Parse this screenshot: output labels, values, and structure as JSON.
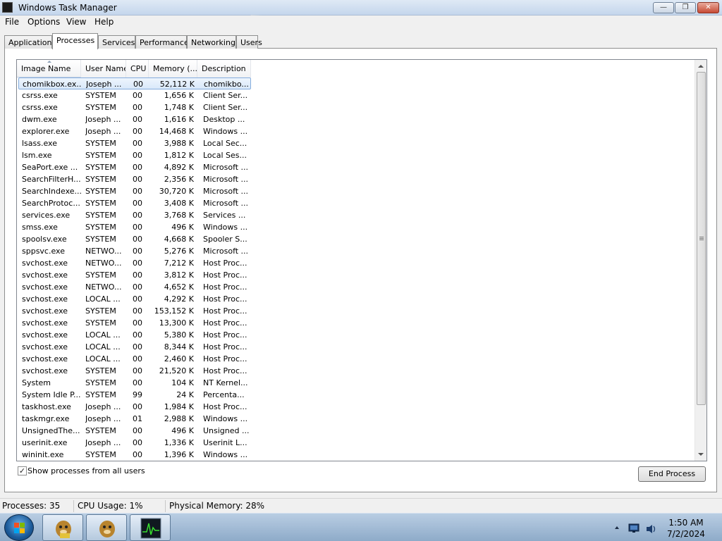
{
  "window": {
    "title": "Windows Task Manager",
    "buttons": {
      "minimize": "—",
      "maximize": "❐",
      "close": "✕"
    }
  },
  "menu": [
    "File",
    "Options",
    "View",
    "Help"
  ],
  "tabs": [
    "Applications",
    "Processes",
    "Services",
    "Performance",
    "Networking",
    "Users"
  ],
  "active_tab": "Processes",
  "columns": [
    "Image Name",
    "User Name",
    "CPU",
    "Memory (...",
    "Description"
  ],
  "processes": [
    {
      "name": "chomikbox.ex...",
      "user": "Joseph ...",
      "cpu": "00",
      "mem": "52,112 K",
      "desc": "chomikbo..."
    },
    {
      "name": "csrss.exe",
      "user": "SYSTEM",
      "cpu": "00",
      "mem": "1,656 K",
      "desc": "Client Ser..."
    },
    {
      "name": "csrss.exe",
      "user": "SYSTEM",
      "cpu": "00",
      "mem": "1,748 K",
      "desc": "Client Ser..."
    },
    {
      "name": "dwm.exe",
      "user": "Joseph ...",
      "cpu": "00",
      "mem": "1,616 K",
      "desc": "Desktop ..."
    },
    {
      "name": "explorer.exe",
      "user": "Joseph ...",
      "cpu": "00",
      "mem": "14,468 K",
      "desc": "Windows ..."
    },
    {
      "name": "lsass.exe",
      "user": "SYSTEM",
      "cpu": "00",
      "mem": "3,988 K",
      "desc": "Local Sec..."
    },
    {
      "name": "lsm.exe",
      "user": "SYSTEM",
      "cpu": "00",
      "mem": "1,812 K",
      "desc": "Local Ses..."
    },
    {
      "name": "SeaPort.exe ...",
      "user": "SYSTEM",
      "cpu": "00",
      "mem": "4,892 K",
      "desc": "Microsoft ..."
    },
    {
      "name": "SearchFilterH...",
      "user": "SYSTEM",
      "cpu": "00",
      "mem": "2,356 K",
      "desc": "Microsoft ..."
    },
    {
      "name": "SearchIndexe...",
      "user": "SYSTEM",
      "cpu": "00",
      "mem": "30,720 K",
      "desc": "Microsoft ..."
    },
    {
      "name": "SearchProtoc...",
      "user": "SYSTEM",
      "cpu": "00",
      "mem": "3,408 K",
      "desc": "Microsoft ..."
    },
    {
      "name": "services.exe",
      "user": "SYSTEM",
      "cpu": "00",
      "mem": "3,768 K",
      "desc": "Services ..."
    },
    {
      "name": "smss.exe",
      "user": "SYSTEM",
      "cpu": "00",
      "mem": "496 K",
      "desc": "Windows ..."
    },
    {
      "name": "spoolsv.exe",
      "user": "SYSTEM",
      "cpu": "00",
      "mem": "4,668 K",
      "desc": "Spooler S..."
    },
    {
      "name": "sppsvc.exe",
      "user": "NETWO...",
      "cpu": "00",
      "mem": "5,276 K",
      "desc": "Microsoft ..."
    },
    {
      "name": "svchost.exe",
      "user": "NETWO...",
      "cpu": "00",
      "mem": "7,212 K",
      "desc": "Host Proc..."
    },
    {
      "name": "svchost.exe",
      "user": "SYSTEM",
      "cpu": "00",
      "mem": "3,812 K",
      "desc": "Host Proc..."
    },
    {
      "name": "svchost.exe",
      "user": "NETWO...",
      "cpu": "00",
      "mem": "4,652 K",
      "desc": "Host Proc..."
    },
    {
      "name": "svchost.exe",
      "user": "LOCAL ...",
      "cpu": "00",
      "mem": "4,292 K",
      "desc": "Host Proc..."
    },
    {
      "name": "svchost.exe",
      "user": "SYSTEM",
      "cpu": "00",
      "mem": "153,152 K",
      "desc": "Host Proc..."
    },
    {
      "name": "svchost.exe",
      "user": "SYSTEM",
      "cpu": "00",
      "mem": "13,300 K",
      "desc": "Host Proc..."
    },
    {
      "name": "svchost.exe",
      "user": "LOCAL ...",
      "cpu": "00",
      "mem": "5,380 K",
      "desc": "Host Proc..."
    },
    {
      "name": "svchost.exe",
      "user": "LOCAL ...",
      "cpu": "00",
      "mem": "8,344 K",
      "desc": "Host Proc..."
    },
    {
      "name": "svchost.exe",
      "user": "LOCAL ...",
      "cpu": "00",
      "mem": "2,460 K",
      "desc": "Host Proc..."
    },
    {
      "name": "svchost.exe",
      "user": "SYSTEM",
      "cpu": "00",
      "mem": "21,520 K",
      "desc": "Host Proc..."
    },
    {
      "name": "System",
      "user": "SYSTEM",
      "cpu": "00",
      "mem": "104 K",
      "desc": "NT Kernel..."
    },
    {
      "name": "System Idle P...",
      "user": "SYSTEM",
      "cpu": "99",
      "mem": "24 K",
      "desc": "Percenta..."
    },
    {
      "name": "taskhost.exe",
      "user": "Joseph ...",
      "cpu": "00",
      "mem": "1,984 K",
      "desc": "Host Proc..."
    },
    {
      "name": "taskmgr.exe",
      "user": "Joseph ...",
      "cpu": "01",
      "mem": "2,988 K",
      "desc": "Windows ..."
    },
    {
      "name": "UnsignedThe...",
      "user": "SYSTEM",
      "cpu": "00",
      "mem": "496 K",
      "desc": "Unsigned ..."
    },
    {
      "name": "userinit.exe",
      "user": "Joseph ...",
      "cpu": "00",
      "mem": "1,336 K",
      "desc": "Userinit L..."
    },
    {
      "name": "wininit.exe",
      "user": "SYSTEM",
      "cpu": "00",
      "mem": "1,396 K",
      "desc": "Windows ..."
    }
  ],
  "selected_row": 0,
  "show_all_users": {
    "label": "Show processes from all users",
    "checked": true,
    "mark": "✓"
  },
  "end_process_label": "End Process",
  "status": {
    "processes": "Processes: 35",
    "cpu": "CPU Usage: 1%",
    "memory": "Physical Memory: 28%"
  },
  "taskbar": {
    "items": [
      "start-orb",
      "chomikbox-icon",
      "chomikbox-icon",
      "task-manager-icon"
    ],
    "clock_time": "1:50 AM",
    "clock_date": "7/2/2024"
  },
  "icons": [
    "app-icon",
    "sort-arrow-icon",
    "scroll-up-icon",
    "scroll-down-icon",
    "checkbox-icon",
    "tray-arrow-icon",
    "network-icon",
    "volume-icon"
  ],
  "colors": {
    "selection_border": "#84acdd",
    "taskbar": "#8eabc9",
    "close_button": "#c64a34"
  }
}
